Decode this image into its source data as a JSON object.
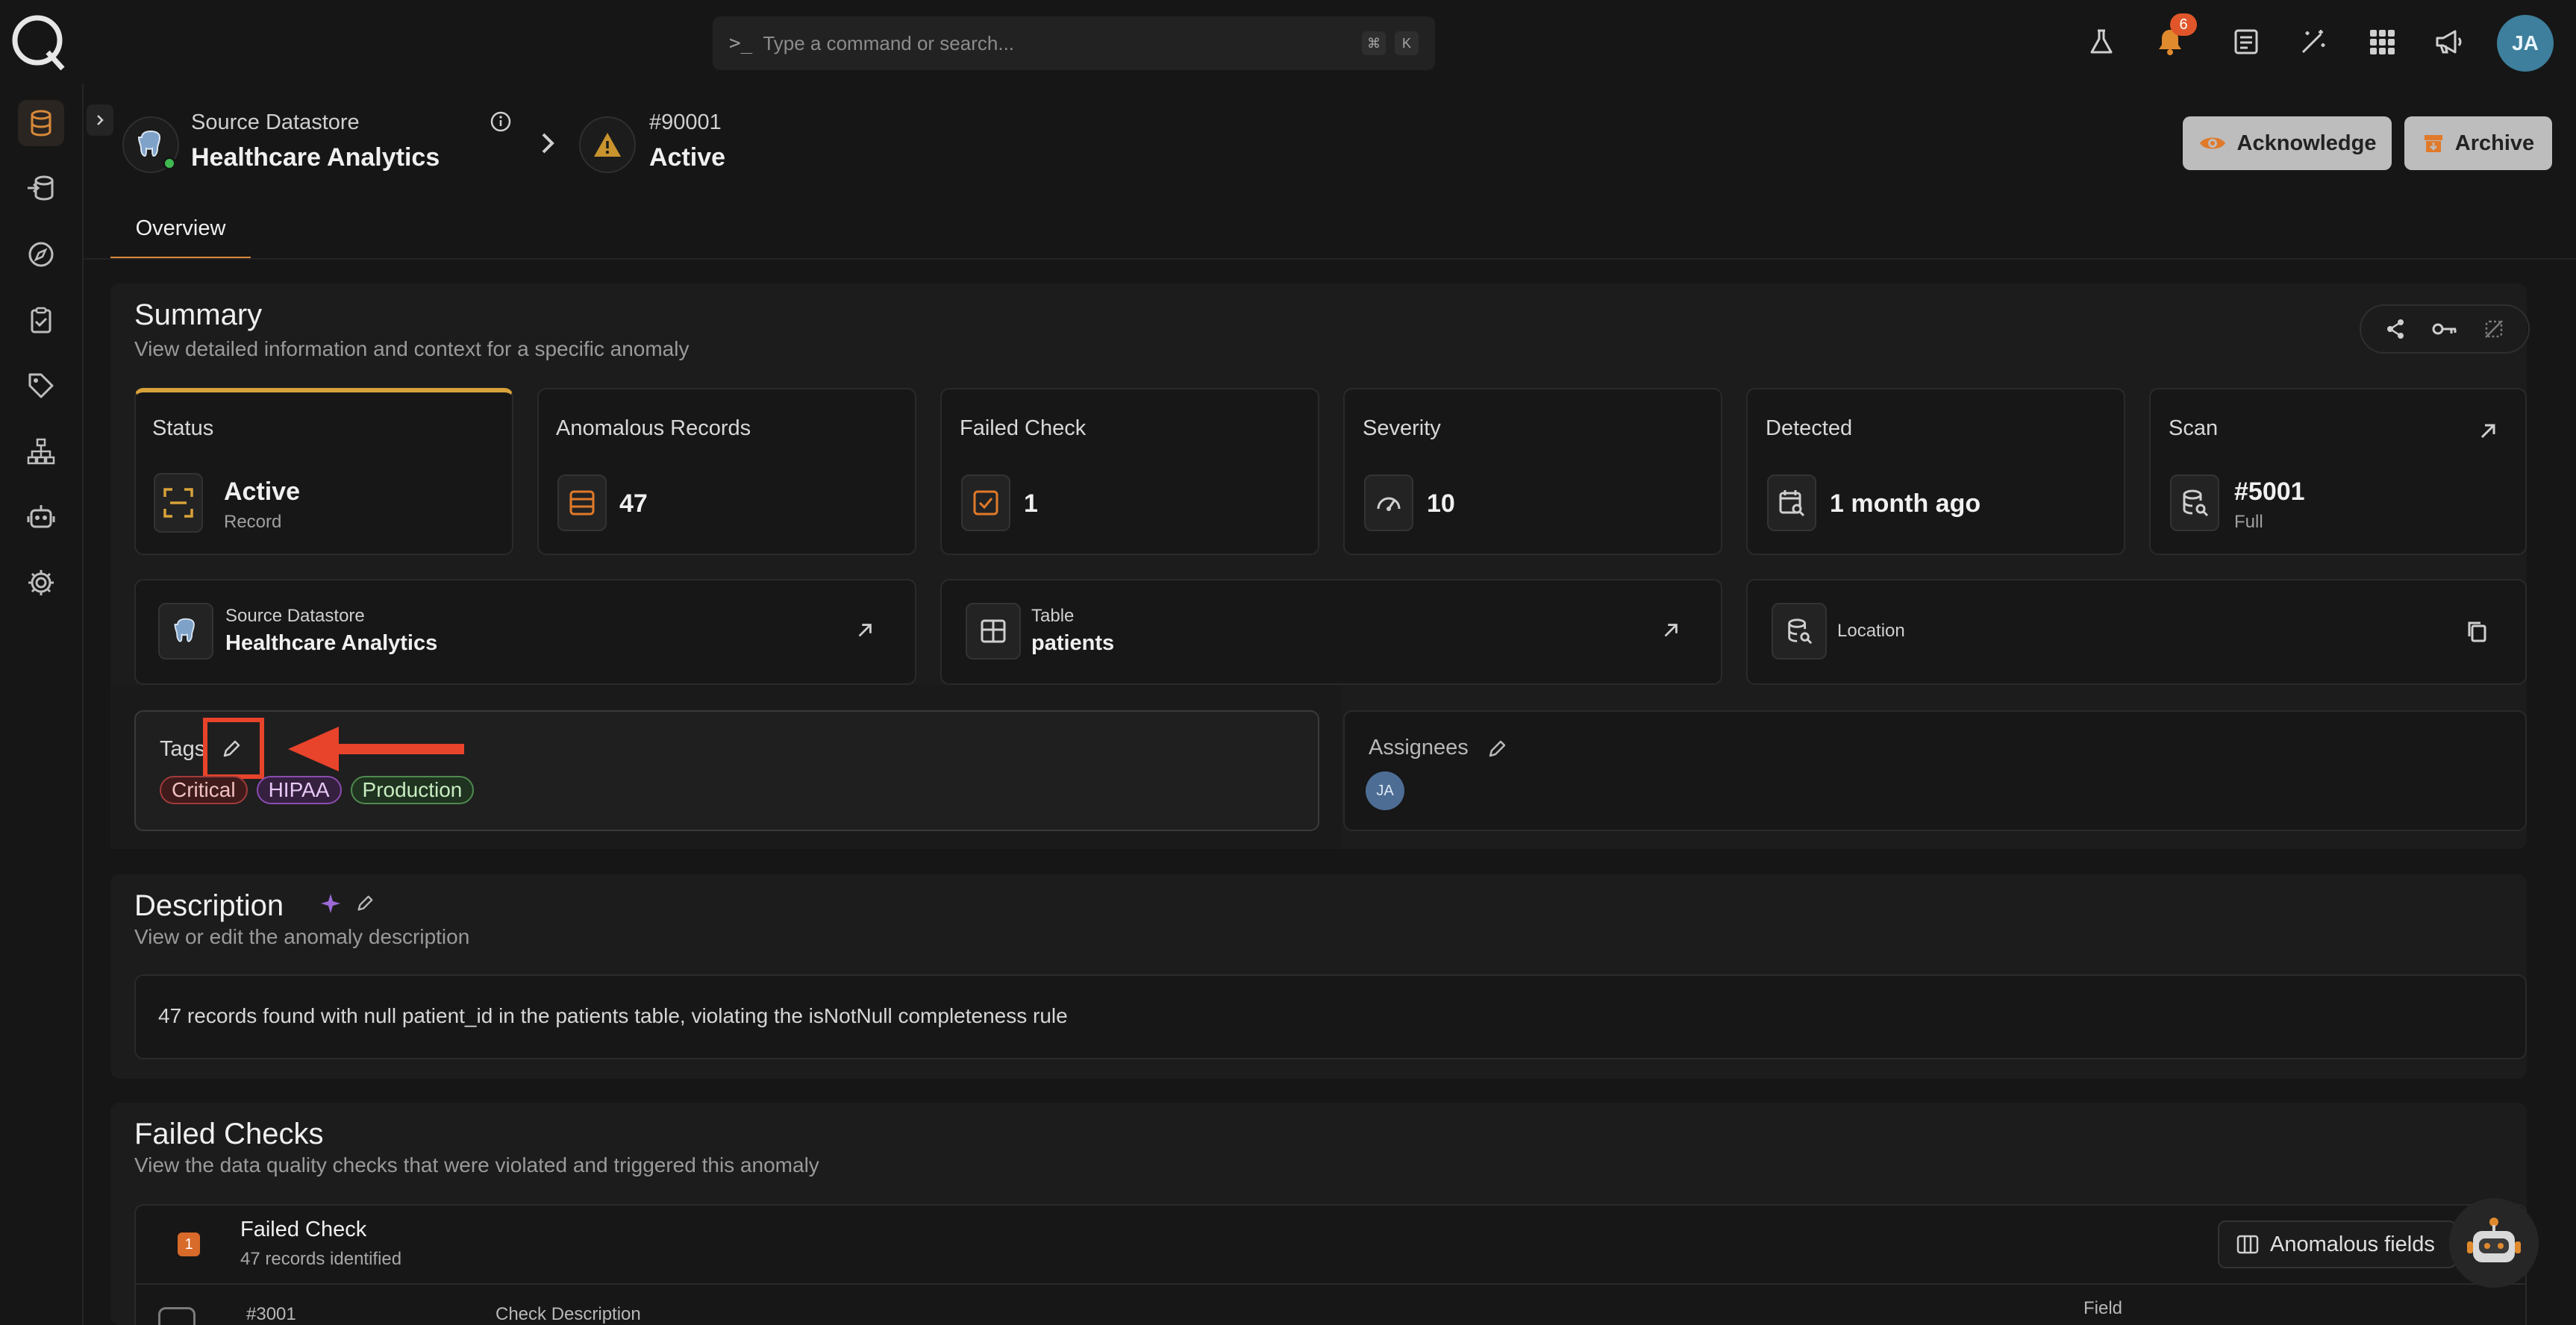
{
  "command_bar": {
    "placeholder": "Type a command or search...",
    "key1": "⌘",
    "key2": "K"
  },
  "notifications": {
    "count": "6"
  },
  "user": {
    "initials": "JA"
  },
  "header": {
    "datastore_sub": "Source Datastore",
    "datastore_title": "Healthcare Analytics",
    "anomaly_id": "#90001",
    "anomaly_status": "Active",
    "acknowledge_label": "Acknowledge",
    "archive_label": "Archive"
  },
  "tabs": [
    {
      "label": "Overview"
    }
  ],
  "summary": {
    "title": "Summary",
    "subtitle": "View detailed information and context for a specific anomaly",
    "stats": {
      "status": {
        "label": "Status",
        "value": "Active",
        "sub": "Record"
      },
      "anomalous_records": {
        "label": "Anomalous Records",
        "value": "47"
      },
      "failed_check": {
        "label": "Failed Check",
        "value": "1"
      },
      "severity": {
        "label": "Severity",
        "value": "10"
      },
      "detected": {
        "label": "Detected",
        "value": "1 month ago"
      },
      "scan": {
        "label": "Scan",
        "value": "#5001",
        "sub": "Full"
      }
    },
    "source_datastore": {
      "label": "Source Datastore",
      "value": "Healthcare Analytics"
    },
    "table": {
      "label": "Table",
      "value": "patients"
    },
    "location": {
      "label": "Location"
    },
    "tags": {
      "label": "Tags",
      "items": [
        "Critical",
        "HIPAA",
        "Production"
      ]
    },
    "assignees": {
      "label": "Assignees",
      "initials": "JA"
    }
  },
  "description": {
    "title": "Description",
    "subtitle": "View or edit the anomaly description",
    "text": "47 records found with null patient_id in the patients table, violating the isNotNull completeness rule"
  },
  "failed_checks": {
    "title": "Failed Checks",
    "subtitle": "View the data quality checks that were violated and triggered this anomaly",
    "item": {
      "number": "1",
      "title": "Failed Check",
      "sub": "47 records identified",
      "check_id": "#3001",
      "col_description": "Check Description",
      "col_field": "Field"
    },
    "anomalous_fields_label": "Anomalous fields"
  },
  "colors": {
    "accent": "#d8893a",
    "annotation": "#e8432b",
    "background": "#161616"
  }
}
